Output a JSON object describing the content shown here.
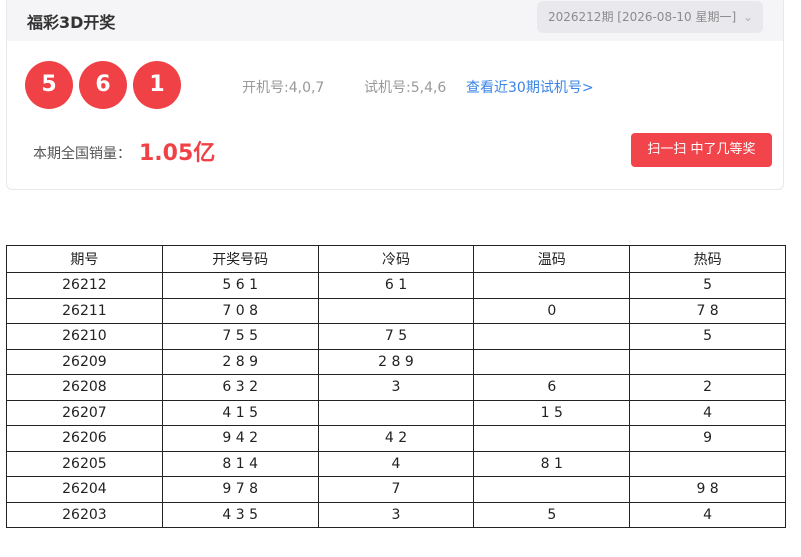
{
  "header": {
    "title": "福彩3D开奖",
    "issue_select": "2026212期 [2026-08-10 星期一]"
  },
  "draw": {
    "balls": [
      "5",
      "6",
      "1"
    ],
    "machine_number": "开机号:4,0,7",
    "test_number": "试机号:5,4,6",
    "test_link": "查看近30期试机号>",
    "sales_label": "本期全国销量：",
    "sales_value": "1.05亿",
    "scan_button": "扫一扫 中了几等奖"
  },
  "table": {
    "columns": [
      "期号",
      "开奖号码",
      "冷码",
      "温码",
      "热码"
    ],
    "rows": [
      [
        "26212",
        "5 6 1",
        "6 1",
        "",
        "5"
      ],
      [
        "26211",
        "7 0 8",
        "",
        "0",
        "7 8"
      ],
      [
        "26210",
        "7 5 5",
        "7 5",
        "",
        "5"
      ],
      [
        "26209",
        "2 8 9",
        "2 8 9",
        "",
        ""
      ],
      [
        "26208",
        "6 3 2",
        "3",
        "6",
        "2"
      ],
      [
        "26207",
        "4 1 5",
        "",
        "1 5",
        "4"
      ],
      [
        "26206",
        "9 4 2",
        "4 2",
        "",
        "9"
      ],
      [
        "26205",
        "8 1 4",
        "4",
        "8 1",
        ""
      ],
      [
        "26204",
        "9 7 8",
        "7",
        "",
        "9 8"
      ],
      [
        "26203",
        "4 3 5",
        "3",
        "5",
        "4"
      ]
    ]
  },
  "colors": {
    "ball": "#ef4146",
    "link": "#3a84e8",
    "button": "#f2454b"
  },
  "icons": {
    "select_arrow": "chevron-down-icon"
  }
}
